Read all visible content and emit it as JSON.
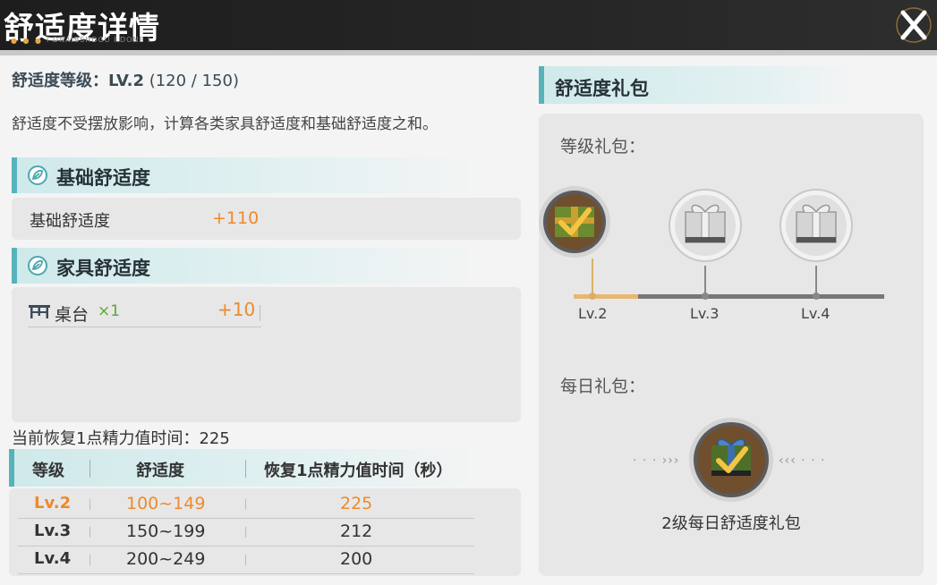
{
  "header": {
    "title": "舒适度详情",
    "close_icon": "close-icon"
  },
  "comfort": {
    "level_label": "舒适度等级：",
    "level_value": "LV.2",
    "progress_text": "(120 / 150)",
    "progress": {
      "current": 120,
      "max": 150
    },
    "description": "舒适度不受摆放影响，计算各类家具舒适度和基础舒适度之和。"
  },
  "base_section": {
    "title": "基础舒适度",
    "icon": "leaf-icon",
    "rows": [
      {
        "label": "基础舒适度",
        "value": "+110"
      }
    ]
  },
  "furniture_section": {
    "title": "家具舒适度",
    "icon": "leaf-icon",
    "items": [
      {
        "icon": "table-icon",
        "name": "桌台",
        "count": "×1",
        "value": "+10"
      }
    ]
  },
  "recovery": {
    "label": "当前恢复1点精力值时间：",
    "value": "225",
    "headers": [
      "等级",
      "舒适度",
      "恢复1点精力值时间（秒）"
    ],
    "rows": [
      {
        "level": "Lv.2",
        "range": "100~149",
        "time": "225",
        "active": true
      },
      {
        "level": "Lv.3",
        "range": "150~199",
        "time": "212",
        "active": false
      },
      {
        "level": "Lv.4",
        "range": "200~249",
        "time": "200",
        "active": false
      }
    ]
  },
  "gift_panel": {
    "title": "舒适度礼包",
    "level_gifts_label": "等级礼包：",
    "level_gifts": [
      {
        "level": "Lv.2",
        "claimed": true
      },
      {
        "level": "Lv.3",
        "claimed": false
      },
      {
        "level": "Lv.4",
        "claimed": false
      }
    ],
    "daily_label": "每日礼包：",
    "daily_gift_name": "2级每日舒适度礼包",
    "daily_claimed": true
  },
  "colors": {
    "accent": "#56b3ba",
    "highlight": "#ee8a2a",
    "count_green": "#5aa832",
    "header_bg": "#1d1d1d"
  }
}
